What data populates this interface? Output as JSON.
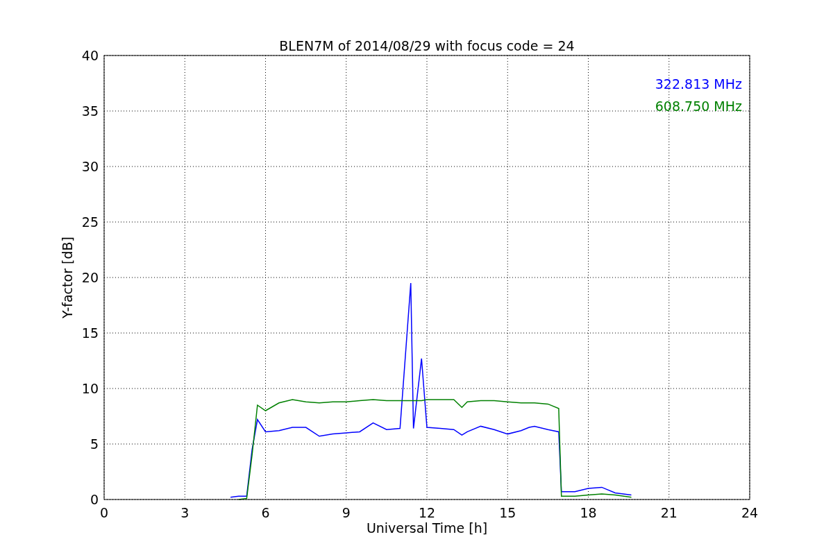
{
  "figure": {
    "chart_data": {
      "type": "line",
      "title": "BLEN7M of 2014/08/29 with focus code = 24",
      "xlabel": "Universal Time [h]",
      "ylabel": "Y-factor [dB]",
      "x": [
        4.7,
        5.0,
        5.3,
        5.5,
        5.7,
        6,
        6.5,
        7,
        7.5,
        8,
        8.5,
        9,
        9.5,
        10,
        10.5,
        11,
        11.4,
        11.5,
        11.8,
        12,
        12.5,
        13,
        13.3,
        13.5,
        14,
        14.5,
        15,
        15.5,
        15.8,
        16,
        16.5,
        16.9,
        17,
        17.5,
        18,
        18.5,
        19,
        19.6
      ],
      "series": [
        {
          "name": "322.813 MHz",
          "color": "#0000ff",
          "values": [
            0.2,
            0.3,
            0.3,
            4.5,
            7.2,
            6.1,
            6.2,
            6.5,
            6.5,
            5.7,
            5.9,
            6.0,
            6.1,
            6.9,
            6.3,
            6.4,
            19.5,
            6.4,
            12.7,
            6.5,
            6.4,
            6.3,
            5.8,
            6.1,
            6.6,
            6.3,
            5.9,
            6.2,
            6.5,
            6.6,
            6.3,
            6.1,
            0.7,
            0.7,
            1.0,
            1.1,
            0.6,
            0.4
          ]
        },
        {
          "name": "608.750 MHz",
          "color": "#008000",
          "values": [
            null,
            0.0,
            0.1,
            4.0,
            8.5,
            8.0,
            8.7,
            9.0,
            8.8,
            8.7,
            8.8,
            8.8,
            8.9,
            9.0,
            8.9,
            8.9,
            8.9,
            8.9,
            8.9,
            9.0,
            9.0,
            9.0,
            8.3,
            8.8,
            8.9,
            8.9,
            8.8,
            8.7,
            8.7,
            8.7,
            8.6,
            8.2,
            0.3,
            0.3,
            0.4,
            0.5,
            0.4,
            0.2
          ]
        }
      ],
      "grid": true,
      "xlim": [
        0,
        24
      ],
      "ylim": [
        0,
        40
      ],
      "xticks": [
        0,
        3,
        6,
        9,
        12,
        15,
        18,
        21,
        24
      ],
      "yticks": [
        0,
        5,
        10,
        15,
        20,
        25,
        30,
        35,
        40
      ]
    }
  }
}
